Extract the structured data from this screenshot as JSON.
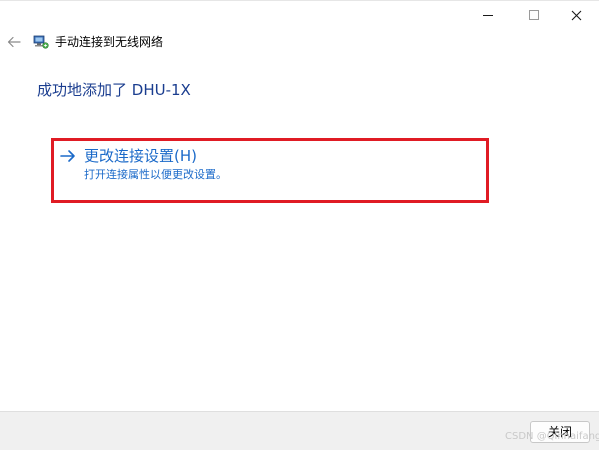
{
  "window": {
    "header_title": "手动连接到无线网络",
    "header_icon": "network-icon"
  },
  "caption": {
    "minimize_icon": "minimize-icon",
    "maximize_icon": "maximize-icon",
    "close_icon": "close-icon"
  },
  "nav": {
    "back_icon": "back-arrow-icon"
  },
  "content": {
    "success_message": "成功地添加了 DHU-1X",
    "option": {
      "title": "更改连接设置(H)",
      "description": "打开连接属性以便更改设置。",
      "icon": "arrow-right-icon"
    }
  },
  "footer": {
    "close_label": "关闭",
    "watermark": "CSDN @Qinhaifang"
  },
  "colors": {
    "link": "#1b6ac9",
    "heading": "#1a3d8f",
    "highlight": "#e01b24",
    "footer_bg": "#f0f0f0"
  }
}
